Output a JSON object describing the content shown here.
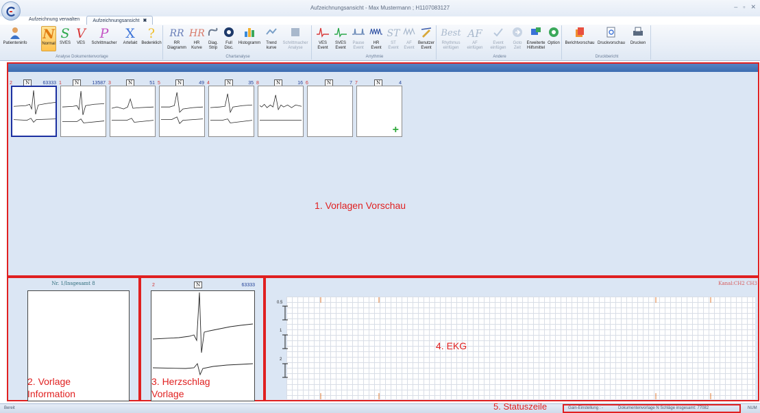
{
  "window": {
    "title": "Aufzeichnungsansicht  -  Max Mustermann ; H1107083127",
    "controls": [
      "–",
      "▫",
      "✕"
    ]
  },
  "tabs": [
    {
      "label": "Aufzeichnung verwalten",
      "active": false
    },
    {
      "label": "Aufzeichnungsansicht",
      "active": true,
      "close": "✖"
    }
  ],
  "ribbon": {
    "groups": [
      {
        "label": "Analyse Dokumentenvorlage",
        "buttons": [
          {
            "label": "Patienteninfo",
            "icon": "person-icon"
          },
          {
            "label": "Normal",
            "glyph": "N",
            "color": "#e07a10",
            "selected": true
          },
          {
            "label": "SVES",
            "glyph": "S",
            "color": "#2aa84a"
          },
          {
            "label": "VES",
            "glyph": "V",
            "color": "#d83a3a"
          },
          {
            "label": "Schrittmacher",
            "glyph": "P",
            "color": "#c452c4"
          },
          {
            "label": "Artefakt",
            "glyph": "X",
            "color": "#3a72d8"
          },
          {
            "label": "Bedenklich",
            "glyph": "?",
            "color": "#f0c030"
          }
        ]
      },
      {
        "label": "Chartanalyse",
        "buttons": [
          {
            "label": "RR Diagramm",
            "glyph": "RR",
            "color": "#6a7fb8"
          },
          {
            "label": "HR Kurve",
            "glyph": "HR",
            "color": "#d87a6a"
          },
          {
            "label": "Diag. Strip",
            "icon": "strip-icon"
          },
          {
            "label": "Full Disc.",
            "icon": "disc-icon"
          },
          {
            "label": "Histogramm",
            "icon": "histogram-icon"
          },
          {
            "label": "Trend kurve",
            "icon": "trend-icon"
          },
          {
            "label": "Schrittmacher Analyse",
            "icon": "pacer-icon",
            "dim": true
          }
        ]
      },
      {
        "label": "Arrythmie",
        "buttons": [
          {
            "label": "VES Event"
          },
          {
            "label": "SVES Event"
          },
          {
            "label": "Pause Event",
            "dim": true
          },
          {
            "label": "HR Event"
          },
          {
            "label": "ST Event",
            "dim": true
          },
          {
            "label": "AF Event",
            "dim": true
          },
          {
            "label": "Benutzer Event"
          }
        ]
      },
      {
        "label": "Andere",
        "buttons": [
          {
            "label": "Rhythmus einfügen",
            "glyph": "Best",
            "dim": true
          },
          {
            "label": "AF einfügen",
            "glyph": "AF",
            "dim": true
          },
          {
            "label": "Event einfügen",
            "dim": true
          },
          {
            "label": "Goto Zeit",
            "dim": true
          },
          {
            "label": "Erweiterte Hilfsmittel"
          },
          {
            "label": "Option"
          }
        ]
      },
      {
        "label": "Druckbericht",
        "buttons": [
          {
            "label": "Berichtvorschau"
          },
          {
            "label": "Druckvorschau"
          },
          {
            "label": "Drucken"
          }
        ]
      }
    ]
  },
  "templates": [
    {
      "index": "2",
      "type": "N",
      "count": "63333",
      "selected": true
    },
    {
      "index": "1",
      "type": "N",
      "count": "13587"
    },
    {
      "index": "3",
      "type": "N",
      "count": "51"
    },
    {
      "index": "5",
      "type": "N",
      "count": "49"
    },
    {
      "index": "4",
      "type": "N",
      "count": "35"
    },
    {
      "index": "8",
      "type": "N",
      "count": "16"
    },
    {
      "index": "6",
      "type": "N",
      "count": "7"
    },
    {
      "index": "7",
      "type": "N",
      "count": "4",
      "add": "+"
    }
  ],
  "sections": {
    "preview": "1. Vorlagen Vorschau",
    "info": "2. Vorlage Information",
    "beat": "3. Herzschlag Vorlage",
    "ekg": "4. EKG",
    "status": "5. Statuszeile"
  },
  "info": {
    "caption": "Nr. 1/Insgesamt 8"
  },
  "beat": {
    "index": "2",
    "type": "N",
    "count": "63333"
  },
  "ekg": {
    "channels_label": "Kanal:CH2 CH3",
    "scale_labels": [
      "0.5",
      "1",
      "2"
    ]
  },
  "status": {
    "left": "Bereit",
    "gain": "Gain-Einstellung :  -",
    "doc": "Dokumentenvorlage N Schläge insgesamt: 77082",
    "mode": "NUM"
  }
}
